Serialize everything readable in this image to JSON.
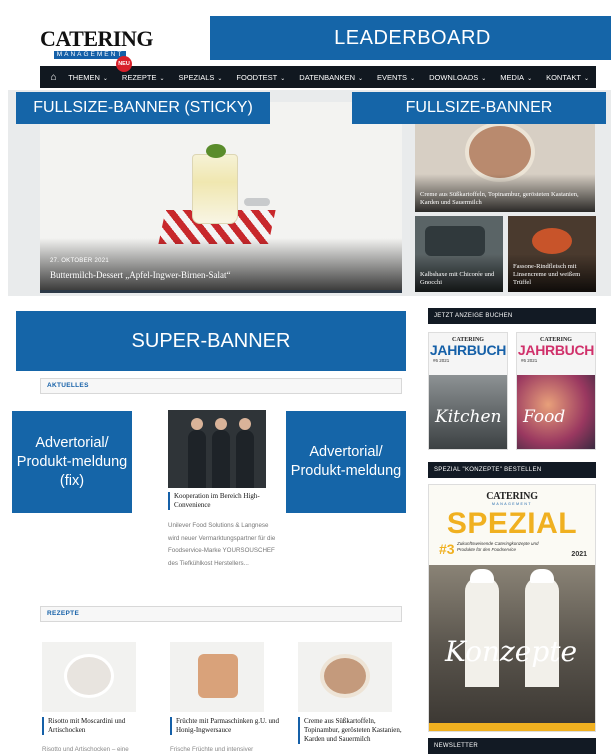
{
  "header": {
    "logo_main": "CATERING",
    "logo_sub": "MANAGEMENT",
    "leaderboard": "LEADERBOARD"
  },
  "nav": {
    "home_icon": "home-icon",
    "badge": "NEU",
    "items": [
      {
        "label": "THEMEN"
      },
      {
        "label": "REZEPTE"
      },
      {
        "label": "SPEZIALS"
      },
      {
        "label": "FOODTEST"
      },
      {
        "label": "DATENBANKEN"
      },
      {
        "label": "EVENTS"
      },
      {
        "label": "DOWNLOADS"
      },
      {
        "label": "MEDIA"
      },
      {
        "label": "KONTAKT"
      }
    ]
  },
  "banners": {
    "fullsize_sticky": "FULLSIZE-BANNER (STICKY)",
    "fullsize": "FULLSIZE-BANNER",
    "super": "SUPER-BANNER",
    "advertorial_fix": "Advertorial/ Produkt-meldung (fix)",
    "advertorial": "Advertorial/ Produkt-meldung"
  },
  "hero": {
    "date": "27. OKTOBER 2021",
    "title": "Buttermilch-Dessert „Apfel-Ingwer-Birnen-Salat“"
  },
  "side_cards": [
    {
      "caption": "Creme aus Süßkartoffeln, Topinambur, gerösteten Kastanien, Karden und Sauermilch"
    },
    {
      "caption": "Kalbshaxe mit Chicorée und Gnocchi"
    },
    {
      "caption": "Fassone-Rindfleisch mit Linsencreme und weißem Trüffel"
    }
  ],
  "sections": {
    "aktuelles": "AKTUELLES",
    "rezepte": "REZEPTE"
  },
  "article": {
    "title": "Kooperation im Bereich High-Convenience",
    "text": "Unilever Food Solutions & Langnese wird neuer Vermarktungspartner für die Foodservice-Marke YOURSOUSCHEF des Tiefkühlkost Herstellers..."
  },
  "recipes": [
    {
      "title": "Risotto mit Moscardini und Artischocken",
      "text": "Risotto und Artischocken – eine"
    },
    {
      "title": "Früchte mit Parmaschinken g.U. und Honig-Ingwersauce",
      "text": "Frische Früchte und intensiver"
    },
    {
      "title": "Creme aus Süßkartoffeln, Topinambur, gerösteten Kastanien, Karden und Sauermilch",
      "text": ""
    }
  ],
  "sidebar": {
    "ad_head": "JETZT ANZEIGE BUCHEN",
    "books": [
      {
        "brand": "CATERING",
        "word": "JAHRBUCH",
        "meta": "#6  2021",
        "script": "Kitchen"
      },
      {
        "brand": "CATERING",
        "word": "JAHRBUCH",
        "meta": "#6  2021",
        "script": "Food"
      }
    ],
    "spezial_head": "SPEZIAL \"KONZEPTE\" BESTELLEN",
    "spezial": {
      "brand": "CATERING",
      "brand_sub": "MANAGEMENT",
      "word": "SPEZIAL",
      "num": "#3",
      "tag": "Zukunftsweisende Cateringkonzepte und Produkte für den Foodservice",
      "year": "2021",
      "script": "Konzepte"
    },
    "newsletter_head": "NEWSLETTER"
  }
}
